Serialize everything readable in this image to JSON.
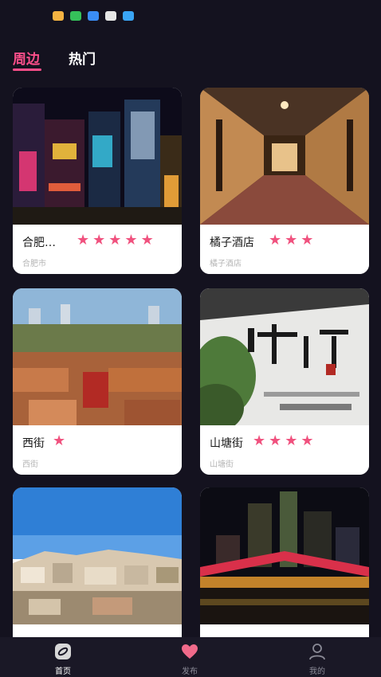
{
  "status_icons": [
    {
      "name": "ribbon-app-icon",
      "color": "#f5b342"
    },
    {
      "name": "wechat-icon",
      "color": "#35c15a"
    },
    {
      "name": "message-icon",
      "color": "#3a8df5"
    },
    {
      "name": "camera-icon",
      "color": "#e6e6e6"
    },
    {
      "name": "text-app-icon",
      "color": "#3aa5f5"
    }
  ],
  "tabs": [
    {
      "label": "周边",
      "active": true
    },
    {
      "label": "热门",
      "active": false
    }
  ],
  "cards": [
    {
      "title": "合肥…",
      "stars": 5,
      "subtitle": "合肥市",
      "photo": "night-city-neon"
    },
    {
      "title": "橘子酒店",
      "stars": 3,
      "subtitle": "橘子酒店",
      "photo": "hotel-corridor"
    },
    {
      "title": "西街",
      "stars": 1,
      "subtitle": "西街",
      "photo": "old-street-aerial"
    },
    {
      "title": "山塘街",
      "stars": 4,
      "subtitle": "山塘街",
      "photo": "suzhou-wall-calligraphy"
    },
    {
      "title": "",
      "stars": 0,
      "subtitle": "",
      "photo": "hillside-town"
    },
    {
      "title": "",
      "stars": 0,
      "subtitle": "",
      "photo": "night-bridge-skyline"
    }
  ],
  "nav": [
    {
      "label": "首页",
      "icon": "home-compass-icon",
      "active": true
    },
    {
      "label": "发布",
      "icon": "heart-icon",
      "active": false
    },
    {
      "label": "我的",
      "icon": "user-icon",
      "active": false
    }
  ],
  "colors": {
    "accent": "#ff4f8b",
    "star": "#f0517e",
    "background": "#14121f"
  }
}
